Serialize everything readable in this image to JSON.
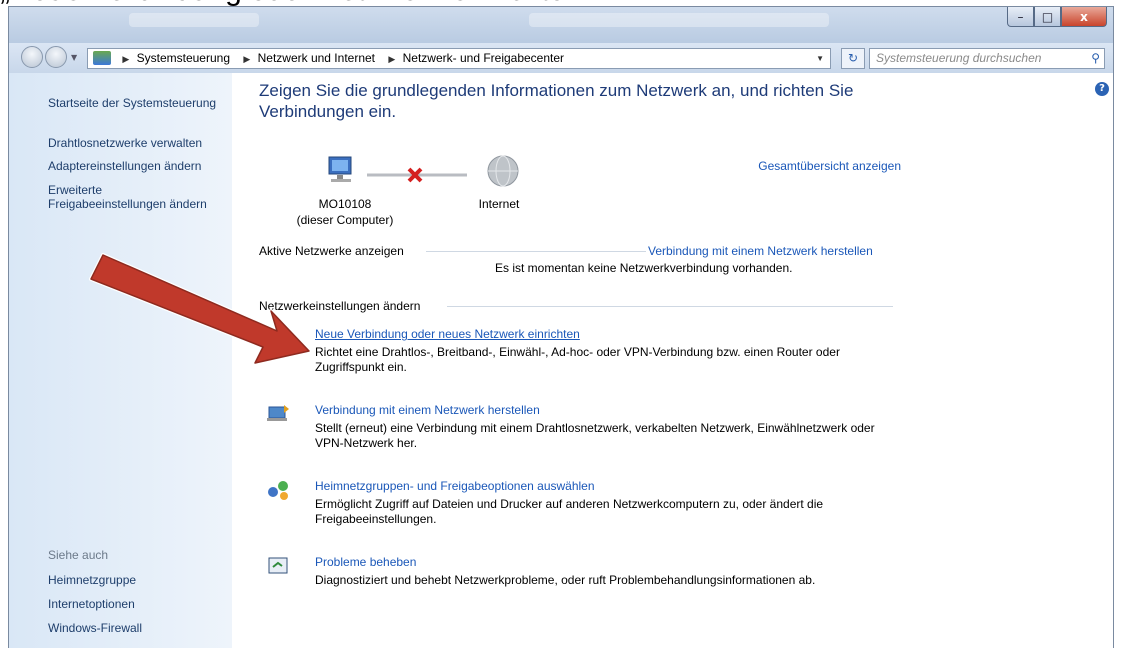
{
  "caption": "„Neue Verbindung oder Netzwerk einrichten\"",
  "window": {
    "min_label": "–",
    "max_label": "□",
    "close_label": "x"
  },
  "address": {
    "crumbs": [
      "Systemsteuerung",
      "Netzwerk und Internet",
      "Netzwerk- und Freigabecenter"
    ],
    "search_placeholder": "Systemsteuerung durchsuchen"
  },
  "sidebar": {
    "items": [
      {
        "label": "Startseite der Systemsteuerung"
      },
      {
        "label": "Drahtlosnetzwerke verwalten"
      },
      {
        "label": "Adaptereinstellungen ändern"
      },
      {
        "label": "Erweiterte"
      },
      {
        "label": "Freigabeeinstellungen ändern"
      }
    ],
    "see_also_title": "Siehe auch",
    "see_also": [
      {
        "label": "Heimnetzgruppe"
      },
      {
        "label": "Internetoptionen"
      },
      {
        "label": "Windows-Firewall"
      }
    ]
  },
  "main": {
    "heading": "Zeigen Sie die grundlegenden Informationen zum Netzwerk an, und richten Sie Verbindungen ein.",
    "full_map_link": "Gesamtübersicht anzeigen",
    "computer_name": "MO10108",
    "computer_note": "(dieser Computer)",
    "internet_label": "Internet",
    "active_networks_title": "Aktive Netzwerke anzeigen",
    "connect_link": "Verbindung mit einem Netzwerk herstellen",
    "no_connection": "Es ist momentan keine Netzwerkverbindung vorhanden.",
    "settings_title": "Netzwerkeinstellungen ändern",
    "tasks": [
      {
        "title": "Neue Verbindung oder neues Netzwerk einrichten",
        "desc": "Richtet eine Drahtlos-, Breitband-, Einwähl-, Ad-hoc- oder VPN-Verbindung bzw. einen Router oder Zugriffspunkt ein."
      },
      {
        "title": "Verbindung mit einem Netzwerk herstellen",
        "desc": "Stellt (erneut) eine Verbindung mit einem Drahtlosnetzwerk, verkabelten Netzwerk, Einwählnetzwerk oder VPN-Netzwerk her."
      },
      {
        "title": "Heimnetzgruppen- und Freigabeoptionen auswählen",
        "desc": "Ermöglicht Zugriff auf Dateien und Drucker auf anderen Netzwerkcomputern zu, oder ändert die Freigabeeinstellungen."
      },
      {
        "title": "Probleme beheben",
        "desc": "Diagnostiziert und behebt Netzwerkprobleme, oder ruft Problembehandlungsinformationen ab."
      }
    ]
  },
  "colors": {
    "link": "#1a57b8",
    "heading": "#1e3b78",
    "annotation_arrow": "#c0392b"
  }
}
